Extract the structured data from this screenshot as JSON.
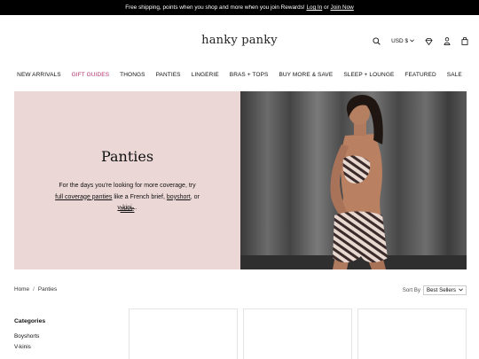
{
  "promo": {
    "text": "Free shipping, points when you shop and more when you join Rewards!",
    "login": "Log In",
    "or": "or",
    "join": "Join Now"
  },
  "header": {
    "logo": "hanky panky",
    "currency": "USD $"
  },
  "nav": {
    "items": [
      "NEW ARRIVALS",
      "GIFT GUIDES",
      "THONGS",
      "PANTIES",
      "LINGERIE",
      "BRAS + TOPS",
      "BUY MORE & SAVE",
      "SLEEP + LOUNGE",
      "FEATURED",
      "SALE"
    ],
    "accent_color": "#b2306b"
  },
  "hero": {
    "title": "Panties",
    "text_1": "For the days you're looking for more coverage, try ",
    "link_1": "full coverage panties",
    "text_2": " like a French brief, ",
    "link_2": "boyshort",
    "text_3": ", or ",
    "link_3": "v-kini",
    "text_4": "...",
    "more": "more",
    "bg_color": "#ebd8d6"
  },
  "breadcrumb": {
    "home": "Home",
    "sep": "/",
    "current": "Panties"
  },
  "sort": {
    "label": "Sort By",
    "value": "Best Sellers"
  },
  "filters": {
    "heading": "Categories",
    "items": [
      "Boyshorts",
      "V-kinis"
    ]
  }
}
